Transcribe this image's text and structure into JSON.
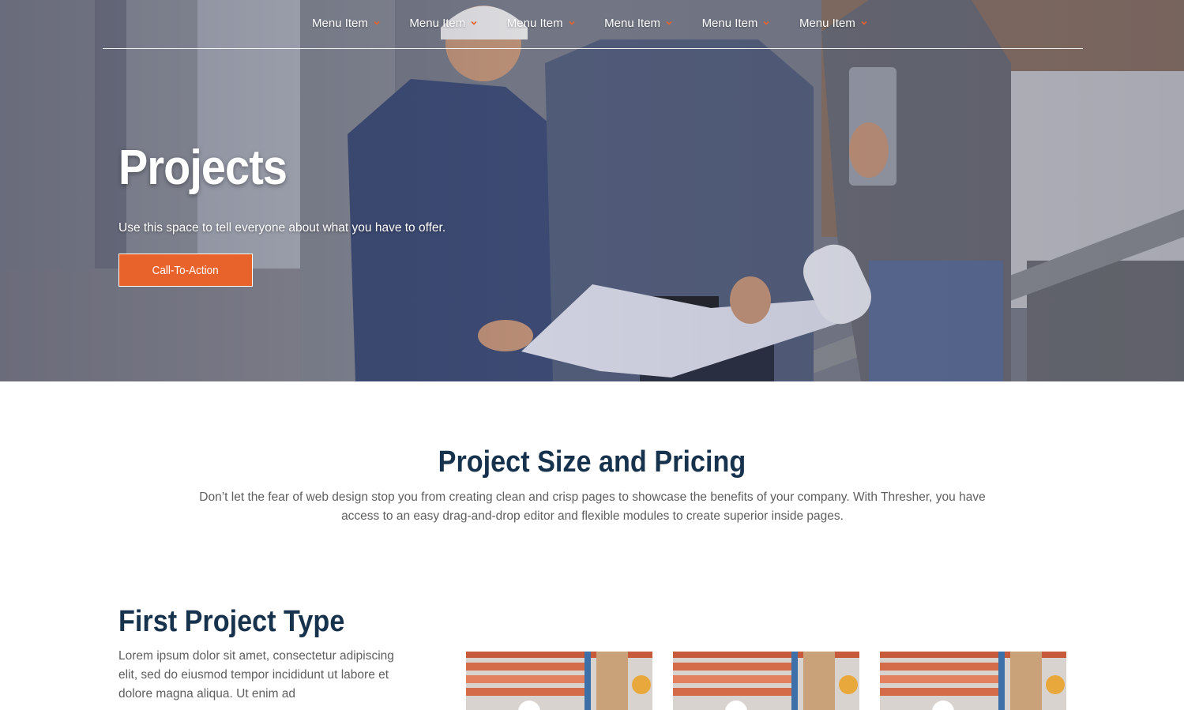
{
  "nav": {
    "items": [
      {
        "label": "Menu Item"
      },
      {
        "label": "Menu Item"
      },
      {
        "label": "Menu Item"
      },
      {
        "label": "Menu Item"
      },
      {
        "label": "Menu Item"
      },
      {
        "label": "Menu Item"
      }
    ]
  },
  "hero": {
    "title": "Projects",
    "subtitle": "Use this space to tell everyone about what you have to offer.",
    "cta_label": "Call-To-Action"
  },
  "section": {
    "title": "Project Size and Pricing",
    "body": "Don’t let the fear of web design stop you from creating clean and crisp pages to showcase the benefits of your company. With Thresher, you have access to an easy drag-and-drop editor and flexible modules to create superior inside pages."
  },
  "project": {
    "title": "First Project Type",
    "body": "Lorem ipsum dolor sit amet, consectetur adipiscing elit, sed do eiusmod tempor incididunt ut labore et dolore magna aliqua. Ut enim ad"
  },
  "colors": {
    "accent": "#e8622c",
    "heading": "#17324d",
    "body_text": "#5e5e5e"
  },
  "icons": {
    "nav_chevron": "chevron-down-icon"
  }
}
